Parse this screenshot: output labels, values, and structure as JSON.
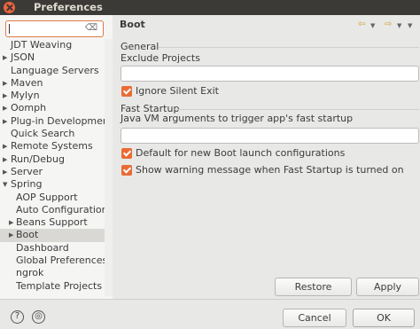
{
  "window": {
    "title": "Preferences"
  },
  "filter": {
    "value": ""
  },
  "tree": [
    {
      "label": "JDT Weaving",
      "arrow": false,
      "child": false,
      "selected": false
    },
    {
      "label": "JSON",
      "arrow": true,
      "child": false,
      "selected": false
    },
    {
      "label": "Language Servers",
      "arrow": false,
      "child": false,
      "selected": false
    },
    {
      "label": "Maven",
      "arrow": true,
      "child": false,
      "selected": false
    },
    {
      "label": "Mylyn",
      "arrow": true,
      "child": false,
      "selected": false
    },
    {
      "label": "Oomph",
      "arrow": true,
      "child": false,
      "selected": false
    },
    {
      "label": "Plug-in Development",
      "arrow": true,
      "child": false,
      "selected": false
    },
    {
      "label": "Quick Search",
      "arrow": false,
      "child": false,
      "selected": false
    },
    {
      "label": "Remote Systems",
      "arrow": true,
      "child": false,
      "selected": false
    },
    {
      "label": "Run/Debug",
      "arrow": true,
      "child": false,
      "selected": false
    },
    {
      "label": "Server",
      "arrow": true,
      "child": false,
      "selected": false
    },
    {
      "label": "Spring",
      "arrow": true,
      "expanded": true,
      "child": false,
      "selected": false
    },
    {
      "label": "AOP Support",
      "arrow": false,
      "child": true,
      "selected": false
    },
    {
      "label": "Auto Configuration",
      "arrow": false,
      "child": true,
      "selected": false
    },
    {
      "label": "Beans Support",
      "arrow": true,
      "child": true,
      "selected": false
    },
    {
      "label": "Boot",
      "arrow": true,
      "child": true,
      "selected": true
    },
    {
      "label": "Dashboard",
      "arrow": false,
      "child": true,
      "selected": false
    },
    {
      "label": "Global Preferences Cu",
      "arrow": false,
      "child": true,
      "selected": false
    },
    {
      "label": "ngrok",
      "arrow": false,
      "child": true,
      "selected": false
    },
    {
      "label": "Template Projects",
      "arrow": false,
      "child": true,
      "selected": false
    }
  ],
  "page": {
    "title": "Boot",
    "general": {
      "group_label": "General",
      "exclude_label": "Exclude Projects",
      "exclude_value": "",
      "ignore_silent_exit": {
        "label": "Ignore Silent Exit",
        "checked": true
      }
    },
    "fast_startup": {
      "group_label": "Fast Startup",
      "jvm_args_label": "Java VM arguments to trigger app's fast startup",
      "jvm_args_value": "",
      "default_new": {
        "label": "Default for new Boot launch configurations",
        "checked": true
      },
      "show_warning": {
        "label": "Show warning message when Fast Startup is turned on",
        "checked": true
      }
    },
    "restore_defaults_label": "Restore Defaults",
    "apply_label": "Apply"
  },
  "footer": {
    "help_icon": "help-icon",
    "import_export_icon": "import-export-icon",
    "cancel_label": "Cancel",
    "ok_label": "OK"
  },
  "colors": {
    "accent": "#e96b35",
    "titlebar": "#3b3a36",
    "nav_arrows": "#d4a32c"
  }
}
